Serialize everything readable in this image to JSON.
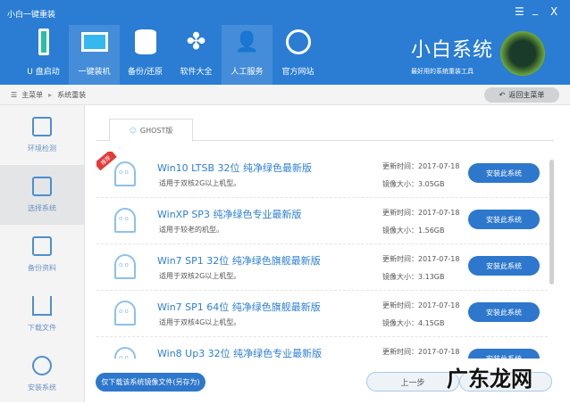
{
  "window": {
    "title": "小白一键重装",
    "menu": "☰",
    "minimize": "_",
    "close": "X"
  },
  "nav": [
    {
      "label": "U 盘启动"
    },
    {
      "label": "一键装机"
    },
    {
      "label": "备份/还原"
    },
    {
      "label": "软件大全"
    },
    {
      "label": "人工服务"
    },
    {
      "label": "官方网站"
    }
  ],
  "brand": {
    "name": "小白系统",
    "slogan": "最好用的系统重装工具"
  },
  "breadcrumb": {
    "root": "主菜单",
    "current": "系统重装",
    "back": "返回主菜单"
  },
  "sidebar": [
    {
      "label": "环境检测"
    },
    {
      "label": "选择系统"
    },
    {
      "label": "备份资料"
    },
    {
      "label": "下载文件"
    },
    {
      "label": "安装系统"
    }
  ],
  "tab": "GHOST版",
  "recommend": "推荐",
  "systems": [
    {
      "name": "Win10 LTSB 32位 纯净绿色最新版",
      "desc": "适用于双核2G以上机型。",
      "updated": "更新时间：2017-07-18",
      "size": "镜像大小：3.05GB",
      "button": "安装此系统"
    },
    {
      "name": "WinXP SP3 纯净绿色专业最新版",
      "desc": "适用于较老的机型。",
      "updated": "更新时间：2017-07-18",
      "size": "镜像大小：1.56GB",
      "button": "安装此系统"
    },
    {
      "name": "Win7 SP1 32位 纯净绿色旗舰最新版",
      "desc": "适用于双核2G以上机型。",
      "updated": "更新时间：2017-07-18",
      "size": "镜像大小：3.13GB",
      "button": "安装此系统"
    },
    {
      "name": "Win7 SP1 64位 纯净绿色旗舰最新版",
      "desc": "适用于双核4G以上机型。",
      "updated": "更新时间：2017-07-18",
      "size": "镜像大小：4.15GB",
      "button": "安装此系统"
    },
    {
      "name": "Win8 Up3 32位 纯净绿色专业最新版",
      "desc": "",
      "updated": "更新时间：2017-07-18",
      "size": "",
      "button": "安装此系统"
    }
  ],
  "footer": {
    "download_only": "仅下载该系统镜像文件(另存为)",
    "prev": "上一步"
  },
  "watermark": "广东龙网"
}
